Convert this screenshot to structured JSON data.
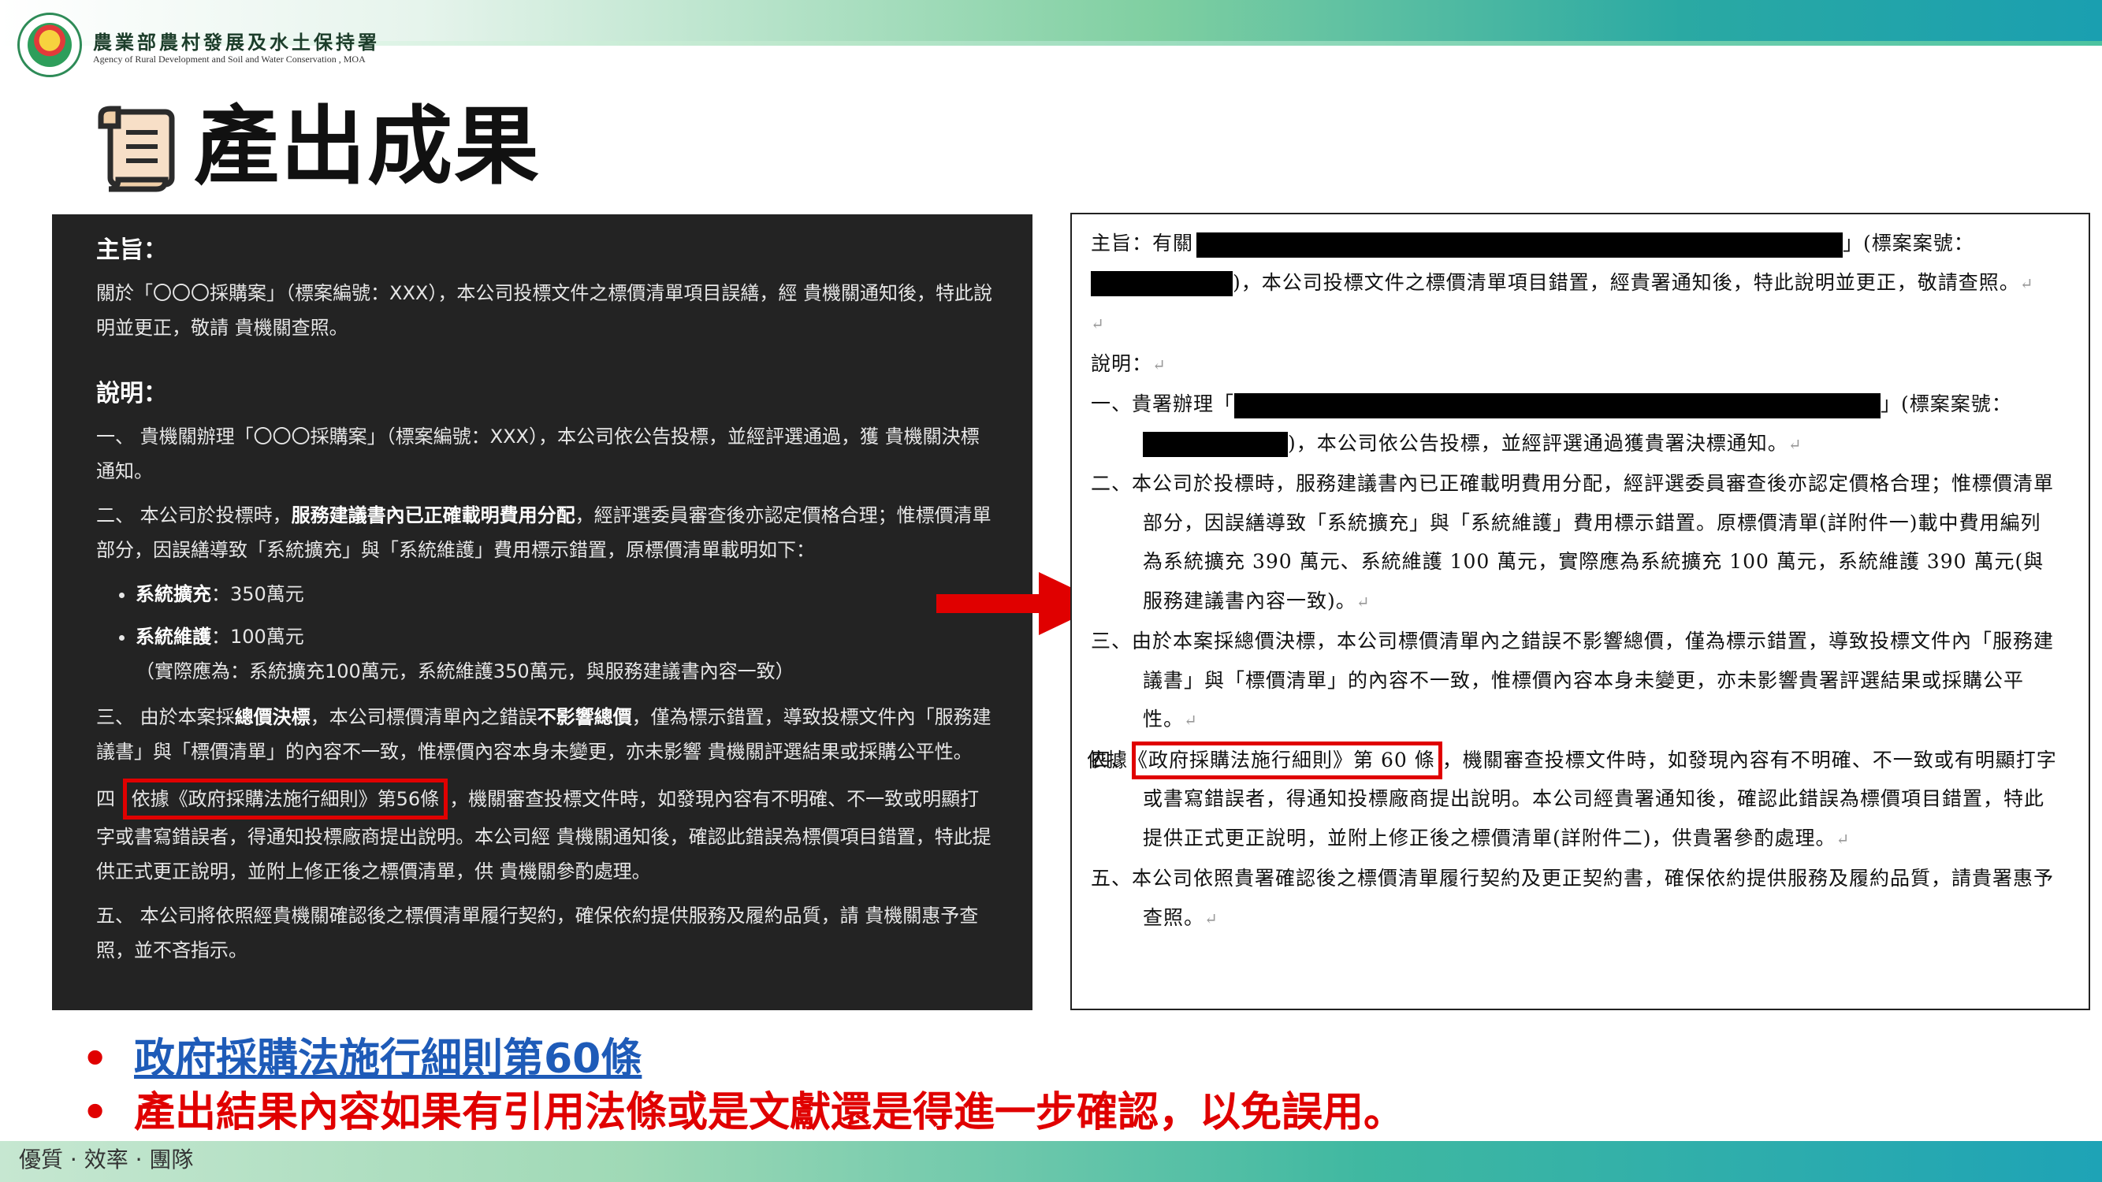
{
  "header": {
    "agency_zh": "農業部農村發展及水土保持署",
    "agency_en": "Agency of Rural Development and Soil and Water Conservation , MOA",
    "title": "產出成果"
  },
  "left_doc": {
    "subject_head": "主旨：",
    "subject_text": "關於「〇〇〇採購案」（標案編號：XXX），本公司投標文件之標價清單項目誤繕，經 貴機關通知後，特此說明並更正，敬請 貴機關查照。",
    "explain_head": "說明：",
    "item1": "一、 貴機關辦理「〇〇〇採購案」（標案編號：XXX），本公司依公告投標，並經評選通過，獲 貴機關決標通知。",
    "item2_pre": "二、 本公司於投標時，",
    "item2_bold": "服務建議書內已正確載明費用分配",
    "item2_post": "，經評選委員審查後亦認定價格合理；惟標價清單部分，因誤繕導致「系統擴充」與「系統維護」費用標示錯置，原標價清單載明如下：",
    "bullet1_label": "系統擴充",
    "bullet1_value": "：350萬元",
    "bullet2_label": "系統維護",
    "bullet2_value": "：100萬元",
    "bullet2_note": "（實際應為：系統擴充100萬元，系統維護350萬元，與服務建議書內容一致）",
    "item3_pre": "三、 由於本案採",
    "item3_bold": "總價決標",
    "item3_mid": "，本公司標價清單內之錯誤",
    "item3_bold2": "不影響總價",
    "item3_post": "，僅為標示錯置，導致投標文件內「服務建議書」與「標價清單」的內容不一致，惟標價內容本身未變更，亦未影響 貴機關評選結果或採購公平性。",
    "item4_num": "四",
    "item4_boxed": "依據《政府採購法施行細則》第56條",
    "item4_post": "，機關審查投標文件時，如發現內容有不明確、不一致或明顯打字或書寫錯誤者，得通知投標廠商提出說明。本公司經 貴機關通知後，確認此錯誤為標價項目錯置，特此提供正式更正說明，並附上修正後之標價清單，供 貴機關參酌處理。",
    "item5": "五、 本公司將依照經貴機關確認後之標價清單履行契約，確保依約提供服務及履約品質，請 貴機關惠予查照，並不吝指示。"
  },
  "right_doc": {
    "subject_a": "主旨：有關",
    "subject_b": "」(標案案號：",
    "subject_c": ")，本公司投標文件之標價清單項目錯置，經貴署通知後，特此說明並更正，敬請查照。",
    "explain_head": "說明：",
    "item1_a": "一、貴署辦理「",
    "item1_b": "」(標案案號：",
    "item1_c": ")，本公司依公告投標，並經評選通過獲貴署決標通知。",
    "item2": "二、本公司於投標時，服務建議書內已正確載明費用分配，經評選委員審查後亦認定價格合理；惟標價清單部分，因誤繕導致「系統擴充」與「系統維護」費用標示錯置。原標價清單(詳附件一)載中費用編列為系統擴充 390 萬元、系統維護 100 萬元，實際應為系統擴充 100 萬元，系統維護 390 萬元(與服務建議書內容一致)。",
    "item3": "三、由於本案採總價決標，本公司標價清單內之錯誤不影響總價，僅為標示錯置，導致投標文件內「服務建議書」與「標價清單」的內容不一致，惟標價內容本身未變更，亦未影響貴署評選結果或採購公平性。",
    "item4_num": "四、",
    "item4_boxed": "依據《政府採購法施行細則》第 60 條",
    "item4_post": "，機關審查投標文件時，如發現內容有不明確、不一致或有明顯打字或書寫錯誤者，得通知投標廠商提出說明。本公司經貴署通知後，確認此錯誤為標價項目錯置，特此提供正式更正說明，並附上修正後之標價清單(詳附件二)，供貴署參酌處理。",
    "item5": "五、本公司依照貴署確認後之標價清單履行契約及更正契約書，確保依約提供服務及履約品質，請貴署惠予查照。"
  },
  "bullets": {
    "b1": "政府採購法施行細則第60條",
    "b2": "產出結果內容如果有引用法條或是文獻還是得進一步確認，以免誤用。"
  },
  "footer": "優質 · 效率 · 團隊",
  "colors": {
    "accent_red": "#e00000",
    "link_blue": "#1e5bb8",
    "dark_bg": "#232323"
  }
}
